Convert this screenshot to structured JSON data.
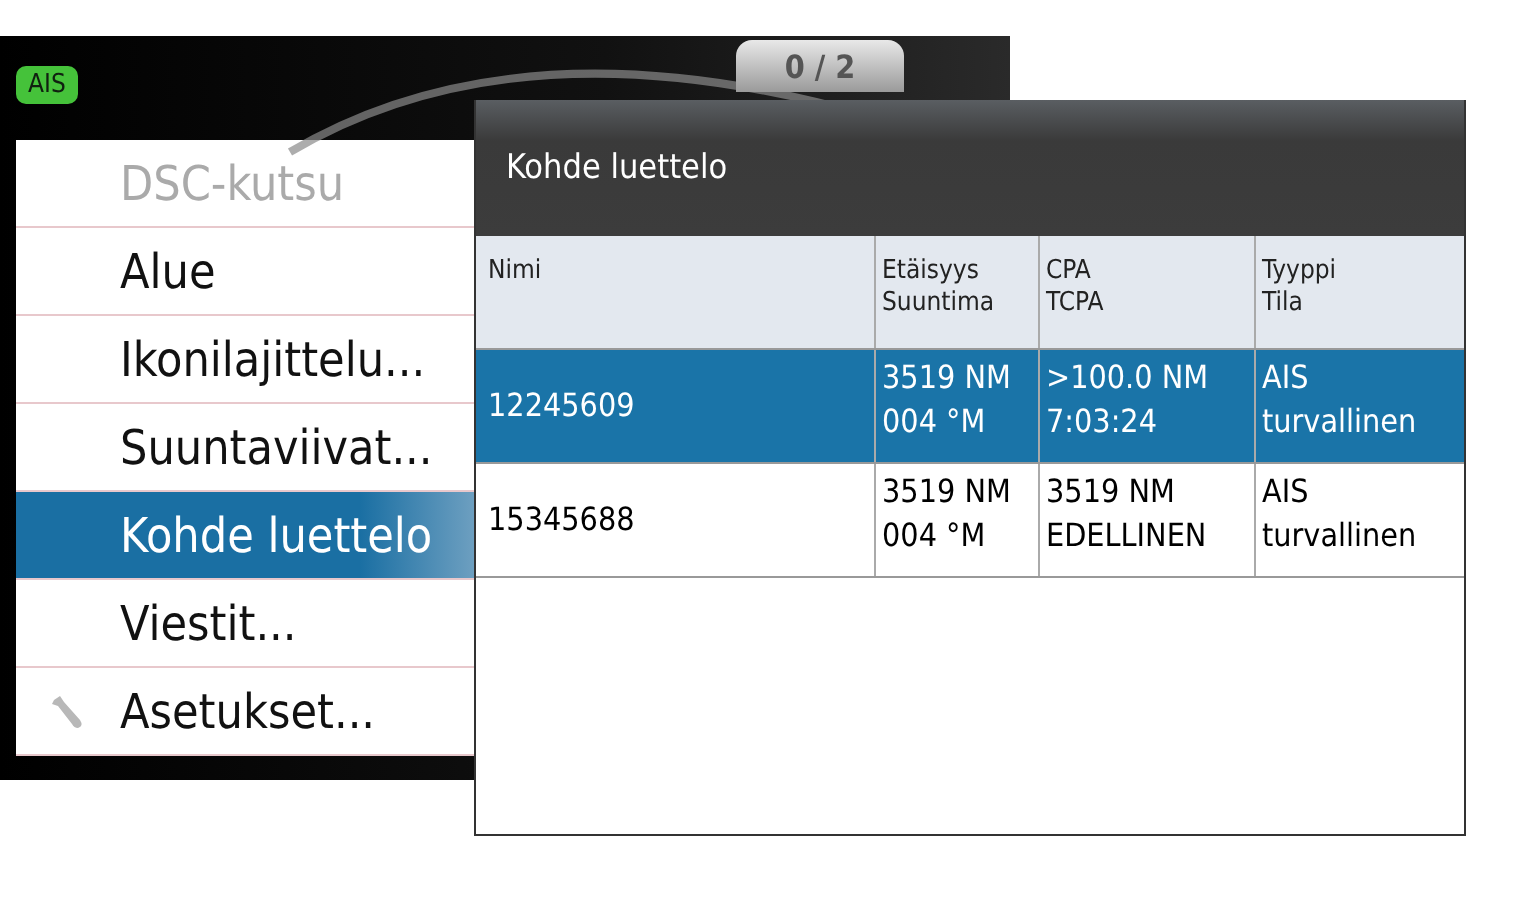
{
  "top_bar": {
    "badge": "AIS",
    "page_counter": "0 / 2"
  },
  "menu": {
    "items": [
      {
        "label": "DSC-kutsu",
        "kind": "plain",
        "disabled": true,
        "selected": false
      },
      {
        "label": "Alue",
        "kind": "plain",
        "disabled": false,
        "selected": false
      },
      {
        "label": "Ikonilajittelu...",
        "kind": "plain",
        "disabled": false,
        "selected": false
      },
      {
        "label": "Suuntaviivat...",
        "kind": "plain",
        "disabled": false,
        "selected": false
      },
      {
        "label": "Kohde luettelo",
        "kind": "plain",
        "disabled": false,
        "selected": true
      },
      {
        "label": "Viestit...",
        "kind": "plain",
        "disabled": false,
        "selected": false
      },
      {
        "label": "Asetukset...",
        "kind": "settings",
        "disabled": false,
        "selected": false
      }
    ]
  },
  "dialog": {
    "title": "Kohde luettelo",
    "table": {
      "columns": [
        "Nimi",
        "Etäisyys\nSuuntima",
        "CPA\nTCPA",
        "Tyyppi\nTila"
      ],
      "rows": [
        {
          "selected": true,
          "cells": [
            "12245609",
            "3519 NM\n004 °M",
            ">100.0 NM\n7:03:24",
            "AIS\nturvallinen"
          ]
        },
        {
          "selected": false,
          "cells": [
            "15345688",
            "3519 NM\n004 °M",
            "3519 NM\nEDELLINEN",
            "AIS\nturvallinen"
          ]
        }
      ]
    }
  }
}
